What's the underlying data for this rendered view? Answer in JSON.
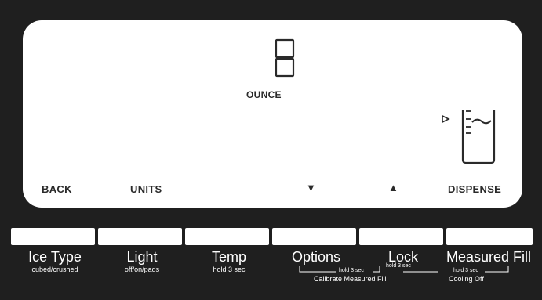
{
  "display": {
    "digit": "8",
    "unit": "OUNCE",
    "labels": {
      "back": "BACK",
      "units": "UNITS",
      "dispense": "DISPENSE"
    },
    "icons": {
      "down": "▼",
      "up": "▲",
      "cup": "cup-fill-level-icon"
    }
  },
  "buttons": [
    {
      "label": "Ice Type",
      "sub": "cubed/crushed"
    },
    {
      "label": "Light",
      "sub": "off/on/pads"
    },
    {
      "label": "Temp",
      "sub": "hold 3 sec"
    },
    {
      "label": "Options",
      "sub": ""
    },
    {
      "label": "Lock",
      "sub": "hold 3 sec"
    },
    {
      "label": "Measured Fill",
      "sub": ""
    }
  ],
  "combos": {
    "calibrate_hold": "hold 3 sec",
    "calibrate_label": "Calibrate Measured Fill",
    "cooling_hold": "hold 3 sec",
    "cooling_label": "Cooling Off"
  }
}
